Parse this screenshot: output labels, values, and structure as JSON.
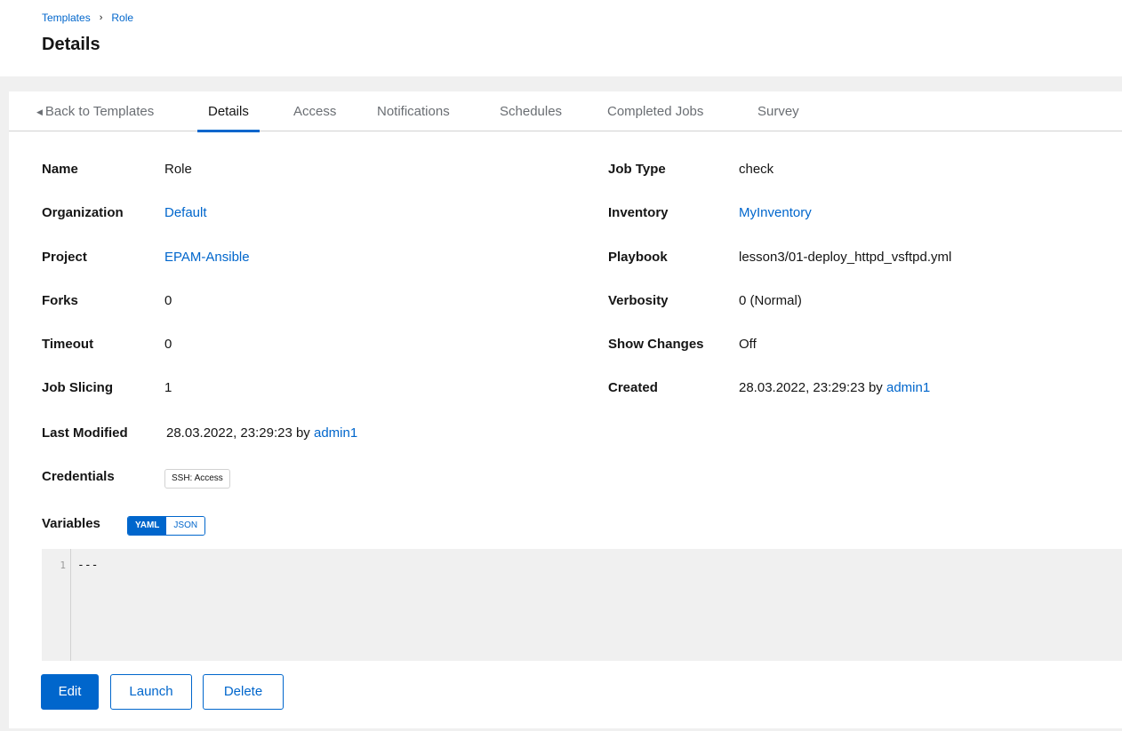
{
  "breadcrumb": {
    "parent": "Templates",
    "separator": "›",
    "current": "Role"
  },
  "page_title": "Details",
  "tabs": {
    "back": "Back to Templates",
    "details": "Details",
    "access": "Access",
    "notifications": "Notifications",
    "schedules": "Schedules",
    "completed_jobs": "Completed Jobs",
    "survey": "Survey"
  },
  "fields_left": {
    "name": {
      "label": "Name",
      "value": "Role"
    },
    "organization": {
      "label": "Organization",
      "value": "Default"
    },
    "project": {
      "label": "Project",
      "value": "EPAM-Ansible"
    },
    "forks": {
      "label": "Forks",
      "value": "0"
    },
    "timeout": {
      "label": "Timeout",
      "value": "0"
    },
    "job_slicing": {
      "label": "Job Slicing",
      "value": "1"
    },
    "last_modified": {
      "label": "Last Modified",
      "date": "28.03.2022, 23:29:23",
      "by": "by",
      "user": "admin1"
    },
    "credentials": {
      "label": "Credentials",
      "chip": "SSH: Access"
    },
    "variables": {
      "label": "Variables",
      "yaml": "YAML",
      "json": "JSON"
    }
  },
  "fields_right": {
    "job_type": {
      "label": "Job Type",
      "value": "check"
    },
    "inventory": {
      "label": "Inventory",
      "value": "MyInventory"
    },
    "playbook": {
      "label": "Playbook",
      "value": "lesson3/01-deploy_httpd_vsftpd.yml"
    },
    "verbosity": {
      "label": "Verbosity",
      "value": "0 (Normal)"
    },
    "show_changes": {
      "label": "Show Changes",
      "value": "Off"
    },
    "created": {
      "label": "Created",
      "date": "28.03.2022, 23:29:23",
      "by": "by",
      "user": "admin1"
    }
  },
  "editor": {
    "line_number": "1",
    "content": "---"
  },
  "actions": {
    "edit": "Edit",
    "launch": "Launch",
    "delete": "Delete"
  },
  "colors": {
    "accent": "#0066cc",
    "background": "#f0f0f0",
    "text": "#151515",
    "muted": "#6a6e73"
  }
}
